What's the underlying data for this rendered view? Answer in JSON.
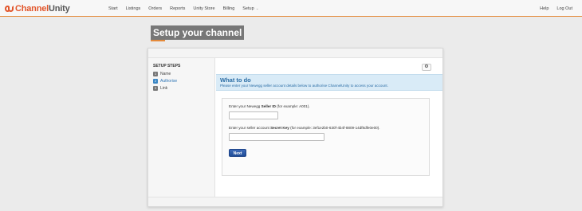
{
  "header": {
    "brand_part1": "Channel",
    "brand_part2": "Unity",
    "nav": [
      "Start",
      "Listings",
      "Orders",
      "Reports",
      "Unity Store",
      "Billing",
      "Setup"
    ],
    "nav_right": [
      "Help",
      "Log Out"
    ]
  },
  "page": {
    "title": "Setup your channel"
  },
  "sidebar": {
    "heading": "SETUP STEPS",
    "steps": [
      {
        "num": "1",
        "label": "Name"
      },
      {
        "num": "2",
        "label": "Authorise"
      },
      {
        "num": "3",
        "label": "Link"
      }
    ]
  },
  "info": {
    "title": "What to do",
    "text": "Please enter your Newegg seller account details below to authorise ChannelUnity to access your account."
  },
  "form": {
    "seller_id_prefix": "Enter your Newegg ",
    "seller_id_bold": "Seller ID",
    "seller_id_suffix": " (for example: A001).",
    "seller_id_value": "",
    "secret_prefix": "Enter your seller account ",
    "secret_bold": "Secret Key",
    "secret_suffix": " (for example: 3ef1e2b0-630f-4b4f-8809-14df8dfe0e00).",
    "secret_value": "",
    "next_label": "Next"
  },
  "colors": {
    "brand_orange": "#e2562b",
    "accent_underline": "#e58a3a",
    "info_bg": "#d9ebf7",
    "info_text": "#2b6da5",
    "button_blue": "#2a5aa8"
  },
  "icons": {
    "settings": "gear-icon",
    "dropdown": "chevron-down-icon"
  }
}
